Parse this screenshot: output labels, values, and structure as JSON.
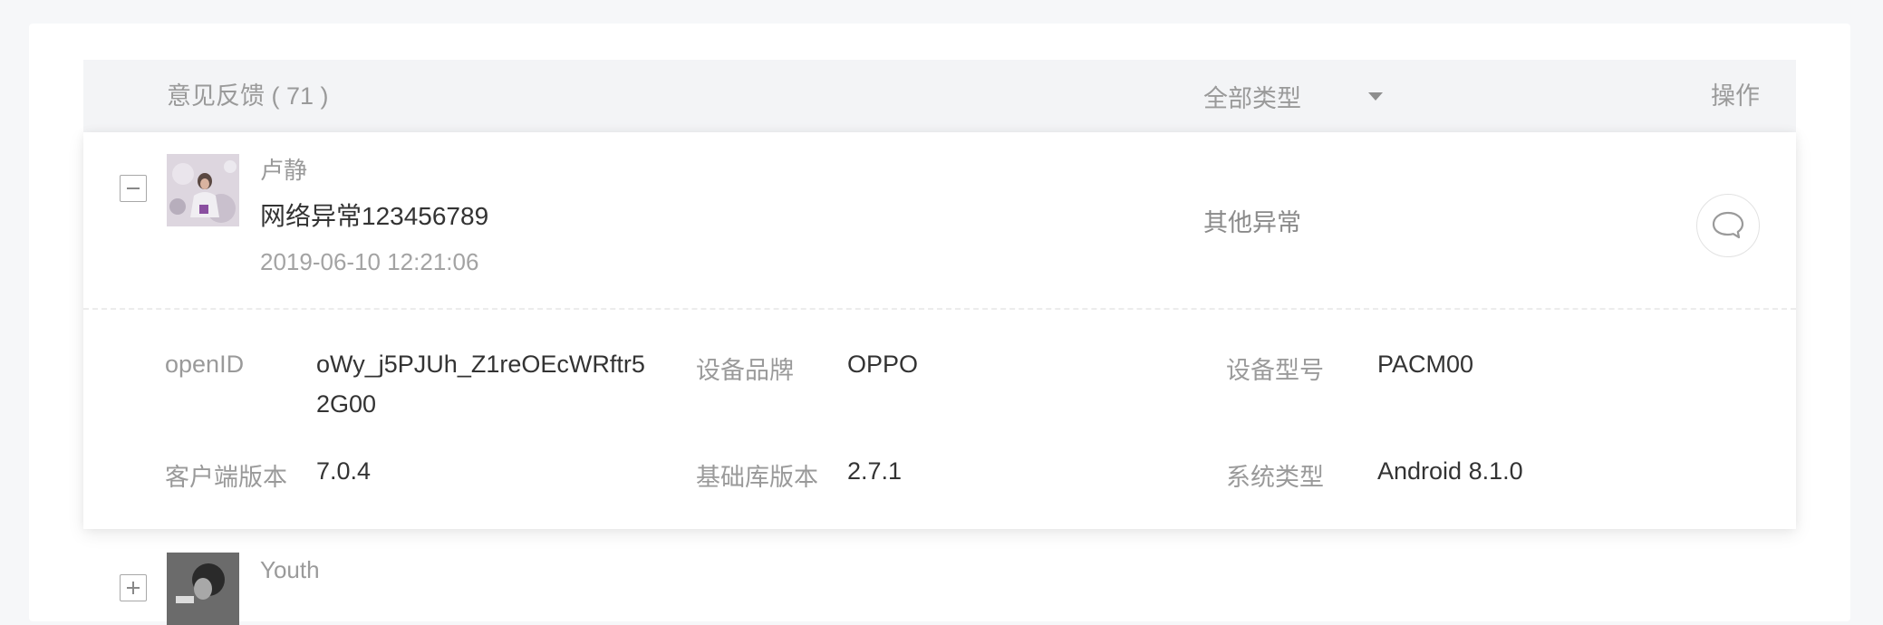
{
  "header": {
    "title": "意见反馈 ( 71 )",
    "filter_label": "全部类型",
    "action_label": "操作"
  },
  "rows": [
    {
      "user_name": "卢静",
      "content": "网络异常123456789",
      "time": "2019-06-10 12:21:06",
      "type": "其他异常",
      "details": {
        "openid_label": "openID",
        "openid_line1": "oWy_j5PJUh_Z1reOEcWRftr5",
        "openid_line2": "2G00",
        "brand_label": "设备品牌",
        "brand_value": "OPPO",
        "model_label": "设备型号",
        "model_value": "PACM00",
        "client_version_label": "客户端版本",
        "client_version_value": "7.0.4",
        "lib_version_label": "基础库版本",
        "lib_version_value": "2.7.1",
        "os_label": "系统类型",
        "os_value": "Android 8.1.0"
      }
    },
    {
      "user_name": "Youth"
    }
  ],
  "icons": {
    "collapse": "minus-square-icon",
    "expand": "plus-square-icon",
    "reply": "comment-bubble-icon",
    "dropdown": "caret-down-icon"
  },
  "colors": {
    "page_bg": "#f6f7f9",
    "header_bg": "#f3f4f6",
    "text_primary": "#333333",
    "text_secondary": "#9a9a9a"
  }
}
